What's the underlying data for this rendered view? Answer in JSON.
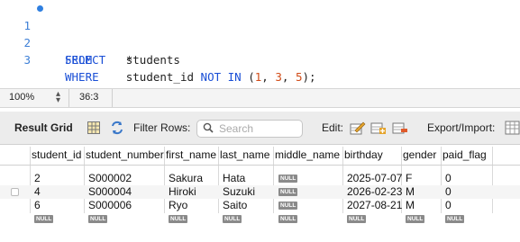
{
  "editor": {
    "lines": [
      {
        "num": "1",
        "kw1": "SELECT",
        "rest": "*"
      },
      {
        "num": "2",
        "kw1": "FROM",
        "rest": "students"
      },
      {
        "num": "3",
        "kw1": "WHERE",
        "col": "student_id",
        "kw2": "NOT IN",
        "open": "(",
        "n1": "1",
        "c1": ", ",
        "n2": "3",
        "c2": ", ",
        "n3": "5",
        "close": ");"
      }
    ]
  },
  "status": {
    "zoom": "100%",
    "cursor": "36:3"
  },
  "toolbar": {
    "result_grid": "Result Grid",
    "filter_rows": "Filter Rows:",
    "search_placeholder": "Search",
    "edit": "Edit:",
    "export_import": "Export/Import:"
  },
  "grid": {
    "columns": [
      "student_id",
      "student_number",
      "first_name",
      "last_name",
      "middle_name",
      "birthday",
      "gender",
      "paid_flag"
    ],
    "rows": [
      [
        "2",
        "S000002",
        "Sakura",
        "Hata",
        "NULL",
        "2025-07-07",
        "F",
        "0"
      ],
      [
        "4",
        "S000004",
        "Hiroki",
        "Suzuki",
        "NULL",
        "2026-02-23",
        "M",
        "0"
      ],
      [
        "6",
        "S000006",
        "Ryo",
        "Saito",
        "NULL",
        "2027-08-21",
        "M",
        "0"
      ]
    ],
    "null_label": "NULL"
  }
}
